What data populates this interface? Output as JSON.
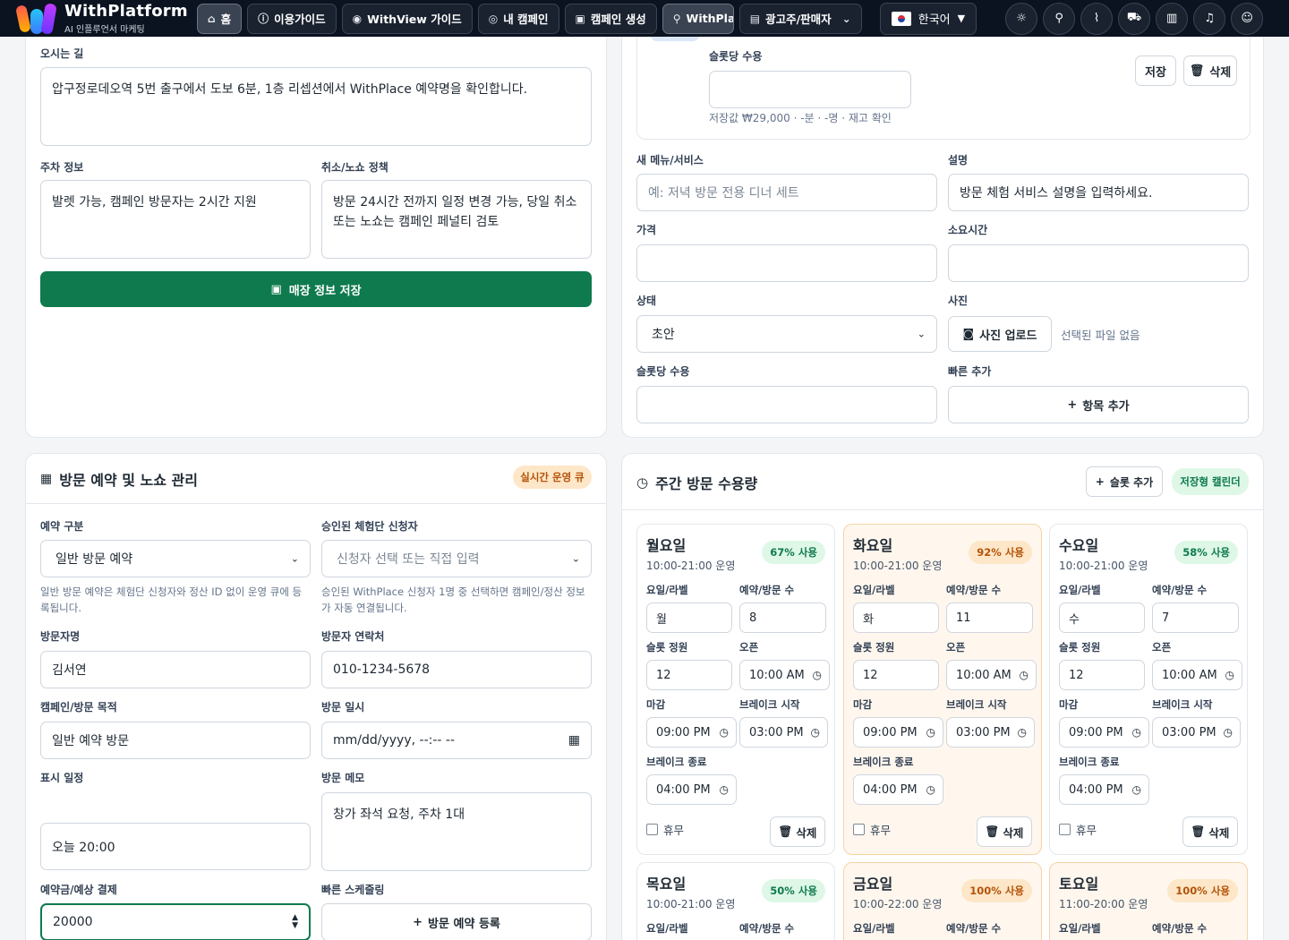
{
  "nav": {
    "brand_title": "WithPlatform",
    "brand_subtitle": "AI 인플루언서 마케팅",
    "items": [
      {
        "label": "홈",
        "icon": "home-icon"
      },
      {
        "label": "이용가이드",
        "icon": "help-circle-icon"
      },
      {
        "label": "WithView 가이드",
        "icon": "eye-icon"
      },
      {
        "label": "내 캠페인",
        "icon": "target-icon"
      },
      {
        "label": "캠페인 생성",
        "icon": "gift-icon"
      },
      {
        "label": "WithPla",
        "icon": "map-pin-icon"
      },
      {
        "label": "광고주/판매자",
        "icon": "clipboard-icon"
      }
    ],
    "language": "한국어",
    "right_icons": [
      "sun-icon",
      "search-icon",
      "activity-icon",
      "cart-icon",
      "map-icon",
      "bell-icon",
      "user-icon"
    ]
  },
  "store": {
    "directions_label": "오시는 길",
    "directions_value": "압구정로데오역 5번 출구에서 도보 6분, 1층 리셉션에서 WithPlace 예약명을 확인합니다.",
    "parking_label": "주차 정보",
    "parking_value": "발렛 가능, 캠페인 방문자는 2시간 지원",
    "cancel_label": "취소/노쇼 정책",
    "cancel_value": "방문 24시간 전까지 일정 변경 가능, 당일 취소 또는 노쇼는 캠페인 페널티 검토",
    "save_label": "매장 정보 저장"
  },
  "menu": {
    "slot_label": "슬롯당 수용",
    "saved_value": "저장값 ₩29,000 · -분 · -명 · 재고 확인",
    "save_btn": "저장",
    "delete_btn": "삭제",
    "new_menu_label": "새 메뉴/서비스",
    "new_menu_placeholder": "예: 저녁 방문 전용 디너 세트",
    "desc_label": "설명",
    "desc_placeholder": "방문 체험 서비스 설명을 입력하세요.",
    "price_label": "가격",
    "duration_label": "소요시간",
    "status_label": "상태",
    "status_value": "초안",
    "photo_label": "사진",
    "photo_btn": "사진 업로드",
    "photo_none": "선택된 파일 없음",
    "slot_cap_label": "슬롯당 수용",
    "quick_add_label": "빠른 추가",
    "add_item_btn": "항목 추가"
  },
  "booking": {
    "title": "방문 예약 및 노쇼 관리",
    "badge": "실시간 운영 큐",
    "type_label": "예약 구분",
    "type_value": "일반 방문 예약",
    "type_help": "일반 방문 예약은 체험단 신청자와 정산 ID 없이 운영 큐에 등록됩니다.",
    "applicant_label": "승인된 체험단 신청자",
    "applicant_placeholder": "신청자 선택 또는 직접 입력",
    "applicant_help": "승인된 WithPlace 신청자 1명 중 선택하면 캠페인/정산 정보가 자동 연결됩니다.",
    "visitor_name_label": "방문자명",
    "visitor_name_value": "김서연",
    "visitor_phone_label": "방문자 연락처",
    "visitor_phone_value": "010-1234-5678",
    "purpose_label": "캠페인/방문 목적",
    "purpose_value": "일반 예약 방문",
    "datetime_label": "방문 일시",
    "datetime_placeholder": "mm/dd/yyyy, --:-- --",
    "display_label": "표시 일정",
    "display_value": "오늘 20:00",
    "memo_label": "방문 메모",
    "memo_value": "창가 좌석 요청, 주차 1대",
    "deposit_label": "예약금/예상 결제",
    "deposit_value": "20000",
    "quick_label": "빠른 스케줄링",
    "register_btn": "방문 예약 등록"
  },
  "weekly": {
    "title": "주간 방문 수용량",
    "add_slot_btn": "슬롯 추가",
    "badge": "저장형 캘린더",
    "field_labels": {
      "day_label": "요일/라벨",
      "visits": "예약/방문 수",
      "capacity": "슬롯 정원",
      "open": "오픈",
      "close": "마감",
      "break_start": "브레이크 시작",
      "break_end": "브레이크 종료",
      "holiday": "휴무",
      "delete": "삭제"
    },
    "days": [
      {
        "name": "월요일",
        "hours": "10:00-21:00 운영",
        "usage": "67% 사용",
        "usage_pct": 67,
        "short": "월",
        "visits": "8",
        "capacity": "12",
        "open": "10:00 AM",
        "close": "09:00 PM",
        "break_start": "03:00 PM",
        "break_end": "04:00 PM",
        "level": "ok"
      },
      {
        "name": "화요일",
        "hours": "10:00-21:00 운영",
        "usage": "92% 사용",
        "usage_pct": 92,
        "short": "화",
        "visits": "11",
        "capacity": "12",
        "open": "10:00 AM",
        "close": "09:00 PM",
        "break_start": "03:00 PM",
        "break_end": "04:00 PM",
        "level": "hi"
      },
      {
        "name": "수요일",
        "hours": "10:00-21:00 운영",
        "usage": "58% 사용",
        "usage_pct": 58,
        "short": "수",
        "visits": "7",
        "capacity": "12",
        "open": "10:00 AM",
        "close": "09:00 PM",
        "break_start": "03:00 PM",
        "break_end": "04:00 PM",
        "level": "ok"
      },
      {
        "name": "목요일",
        "hours": "10:00-21:00 운영",
        "usage": "50% 사용",
        "usage_pct": 50,
        "level": "ok"
      },
      {
        "name": "금요일",
        "hours": "10:00-22:00 운영",
        "usage": "100% 사용",
        "usage_pct": 100,
        "level": "hi"
      },
      {
        "name": "토요일",
        "hours": "11:00-20:00 운영",
        "usage": "100% 사용",
        "usage_pct": 100,
        "level": "hi"
      }
    ]
  },
  "colors": {
    "nav_bg": "#0b1220",
    "primary_green": "#0e7a4d",
    "badge_amber": "#fde7c8",
    "badge_green": "#def7e7",
    "warn_card": "#fff7ee"
  }
}
